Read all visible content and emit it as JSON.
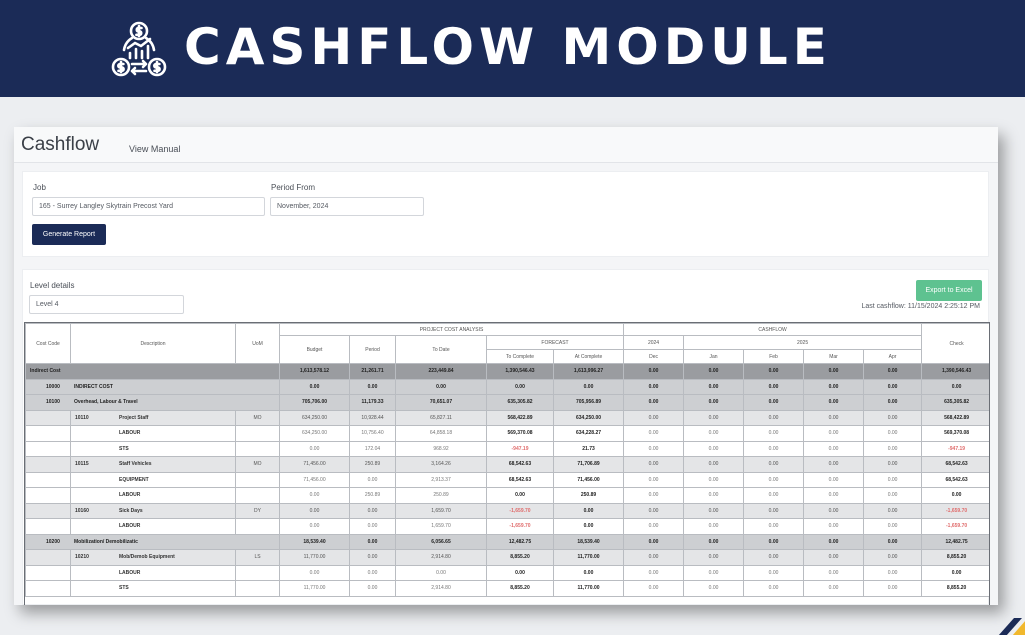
{
  "banner": {
    "title": "CASHFLOW MODULE",
    "logo_icon": "cashflow-dollar-chart-icon"
  },
  "app": {
    "title": "Cashflow",
    "manual_link": "View Manual"
  },
  "filters": {
    "job_label": "Job",
    "job_value": "165 - Surrey Langley Skytrain Precost Yard",
    "period_label": "Period From",
    "period_value": "November, 2024",
    "generate_button": "Generate Report"
  },
  "level": {
    "label": "Level details",
    "value": "Level 4",
    "export_button": "Export to Excel",
    "last_cashflow": "Last cashflow: 11/15/2024 2:25:12 PM"
  },
  "table": {
    "headers": {
      "cost_code": "Cost Code",
      "description": "Description",
      "uom": "UoM",
      "project_cost_analysis": "PROJECT COST ANALYSIS",
      "budget": "Budget",
      "period": "Period",
      "to_date": "To Date",
      "forecast": "FORECAST",
      "to_complete": "To Complete",
      "at_complete": "At Complete",
      "cashflow": "CASHFLOW",
      "year_2024": "2024",
      "year_2025": "2025",
      "dec": "Dec",
      "jan": "Jan",
      "feb": "Feb",
      "mar": "Mar",
      "apr": "Apr",
      "check": "Check"
    },
    "rows": [
      {
        "level": 0,
        "code": "Indirect Cost",
        "desc": "",
        "uom": "",
        "budget": "1,613,578.12",
        "period": "21,261.71",
        "to_date": "223,449.84",
        "to_complete": "1,390,546.43",
        "at_complete": "1,613,996.27",
        "dec": "0.00",
        "jan": "0.00",
        "feb": "0.00",
        "mar": "0.00",
        "apr": "0.00",
        "check": "1,390,546.43"
      },
      {
        "level": 1,
        "code": "10000",
        "desc": "INDIRECT COST",
        "uom": "",
        "budget": "0.00",
        "period": "0.00",
        "to_date": "0.00",
        "to_complete": "0.00",
        "at_complete": "0.00",
        "dec": "0.00",
        "jan": "0.00",
        "feb": "0.00",
        "mar": "0.00",
        "apr": "0.00",
        "check": "0.00"
      },
      {
        "level": 1,
        "code": "10100",
        "desc": "Overhead, Labour & Travel",
        "uom": "",
        "budget": "705,706.00",
        "period": "11,179.33",
        "to_date": "70,651.07",
        "to_complete": "635,305.82",
        "at_complete": "705,956.89",
        "dec": "0.00",
        "jan": "0.00",
        "feb": "0.00",
        "mar": "0.00",
        "apr": "0.00",
        "check": "635,305.82"
      },
      {
        "level": 2,
        "code": "10110",
        "desc": "Project Staff",
        "uom": "MO",
        "budget": "634,250.00",
        "period": "10,928.44",
        "to_date": "65,827.11",
        "to_complete": "568,422.89",
        "at_complete": "634,250.00",
        "dec": "0.00",
        "jan": "0.00",
        "feb": "0.00",
        "mar": "0.00",
        "apr": "0.00",
        "check": "568,422.89"
      },
      {
        "level": 3,
        "code": "",
        "desc": "LABOUR",
        "uom": "",
        "budget": "634,250.00",
        "period": "10,756.40",
        "to_date": "64,858.18",
        "to_complete": "569,370.08",
        "at_complete": "634,228.27",
        "dec": "0.00",
        "jan": "0.00",
        "feb": "0.00",
        "mar": "0.00",
        "apr": "0.00",
        "check": "569,370.08"
      },
      {
        "level": 3,
        "code": "",
        "desc": "STS",
        "uom": "",
        "budget": "0.00",
        "period": "172.04",
        "to_date": "968.92",
        "to_complete": "-947.19",
        "at_complete": "21.73",
        "dec": "0.00",
        "jan": "0.00",
        "feb": "0.00",
        "mar": "0.00",
        "apr": "0.00",
        "check": "-947.19"
      },
      {
        "level": 2,
        "code": "10115",
        "desc": "Staff Vehicles",
        "uom": "MO",
        "budget": "71,456.00",
        "period": "250.89",
        "to_date": "3,164.26",
        "to_complete": "68,542.63",
        "at_complete": "71,706.89",
        "dec": "0.00",
        "jan": "0.00",
        "feb": "0.00",
        "mar": "0.00",
        "apr": "0.00",
        "check": "68,542.63"
      },
      {
        "level": 3,
        "code": "",
        "desc": "EQUIPMENT",
        "uom": "",
        "budget": "71,456.00",
        "period": "0.00",
        "to_date": "2,913.37",
        "to_complete": "68,542.63",
        "at_complete": "71,456.00",
        "dec": "0.00",
        "jan": "0.00",
        "feb": "0.00",
        "mar": "0.00",
        "apr": "0.00",
        "check": "68,542.63"
      },
      {
        "level": 3,
        "code": "",
        "desc": "LABOUR",
        "uom": "",
        "budget": "0.00",
        "period": "250.89",
        "to_date": "250.89",
        "to_complete": "0.00",
        "at_complete": "250.89",
        "dec": "0.00",
        "jan": "0.00",
        "feb": "0.00",
        "mar": "0.00",
        "apr": "0.00",
        "check": "0.00"
      },
      {
        "level": 2,
        "code": "10160",
        "desc": "Sick Days",
        "uom": "DY",
        "budget": "0.00",
        "period": "0.00",
        "to_date": "1,659.70",
        "to_complete": "-1,659.70",
        "at_complete": "0.00",
        "dec": "0.00",
        "jan": "0.00",
        "feb": "0.00",
        "mar": "0.00",
        "apr": "0.00",
        "check": "-1,659.70"
      },
      {
        "level": 3,
        "code": "",
        "desc": "LABOUR",
        "uom": "",
        "budget": "0.00",
        "period": "0.00",
        "to_date": "1,659.70",
        "to_complete": "-1,659.70",
        "at_complete": "0.00",
        "dec": "0.00",
        "jan": "0.00",
        "feb": "0.00",
        "mar": "0.00",
        "apr": "0.00",
        "check": "-1,659.70"
      },
      {
        "level": 1,
        "code": "10200",
        "desc": "Mobilization/ Demobilizatic",
        "uom": "",
        "budget": "18,539.40",
        "period": "0.00",
        "to_date": "6,056.65",
        "to_complete": "12,482.75",
        "at_complete": "18,539.40",
        "dec": "0.00",
        "jan": "0.00",
        "feb": "0.00",
        "mar": "0.00",
        "apr": "0.00",
        "check": "12,482.75"
      },
      {
        "level": 2,
        "code": "10210",
        "desc": "Mob/Demob Equipment",
        "uom": "LS",
        "budget": "11,770.00",
        "period": "0.00",
        "to_date": "2,914.80",
        "to_complete": "8,855.20",
        "at_complete": "11,770.00",
        "dec": "0.00",
        "jan": "0.00",
        "feb": "0.00",
        "mar": "0.00",
        "apr": "0.00",
        "check": "8,855.20"
      },
      {
        "level": 3,
        "code": "",
        "desc": "LABOUR",
        "uom": "",
        "budget": "0.00",
        "period": "0.00",
        "to_date": "0.00",
        "to_complete": "0.00",
        "at_complete": "0.00",
        "dec": "0.00",
        "jan": "0.00",
        "feb": "0.00",
        "mar": "0.00",
        "apr": "0.00",
        "check": "0.00"
      },
      {
        "level": 3,
        "code": "",
        "desc": "STS",
        "uom": "",
        "budget": "11,770.00",
        "period": "0.00",
        "to_date": "2,914.80",
        "to_complete": "8,855.20",
        "at_complete": "11,770.00",
        "dec": "0.00",
        "jan": "0.00",
        "feb": "0.00",
        "mar": "0.00",
        "apr": "0.00",
        "check": "8,855.20"
      }
    ]
  },
  "colors": {
    "banner_bg": "#1b2b57",
    "button_bg": "#1b2b57",
    "export_bg": "#5ec290",
    "negative": "#e06c6c"
  }
}
